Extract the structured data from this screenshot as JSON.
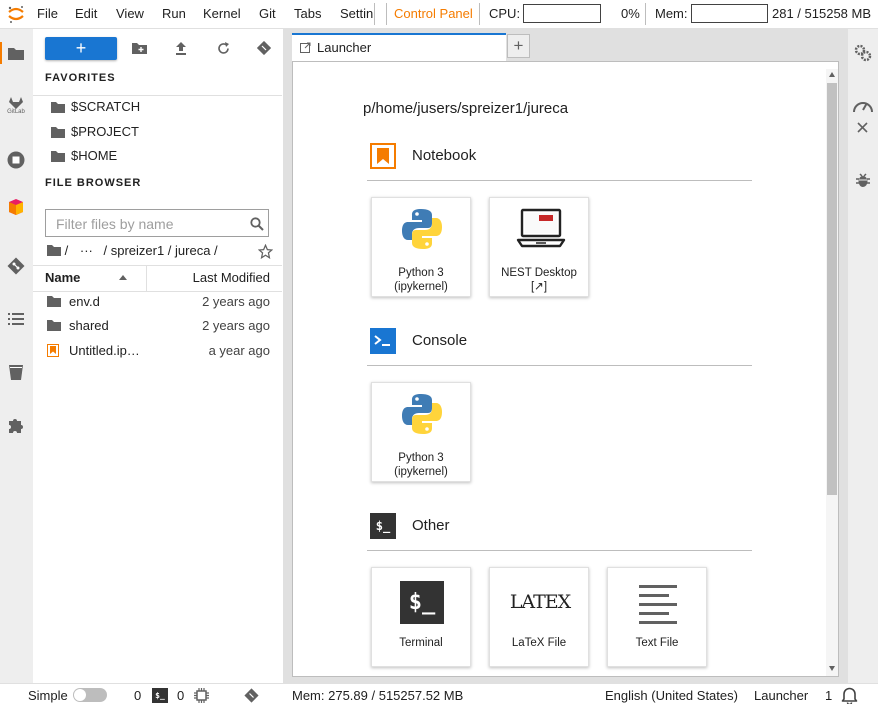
{
  "menubar": {
    "items": [
      "File",
      "Edit",
      "View",
      "Run",
      "Kernel",
      "Git",
      "Tabs",
      "Settin"
    ],
    "control_panel": "Control Panel",
    "cpu_label": "CPU:",
    "cpu_value": "0%",
    "mem_label": "Mem:",
    "mem_value": "281 / 515258 MB"
  },
  "filebrowser": {
    "new_button": "+",
    "favorites_title": "FAVORITES",
    "favorites": [
      "$SCRATCH",
      "$PROJECT",
      "$HOME"
    ],
    "browser_title": "FILE BROWSER",
    "filter_placeholder": "Filter files by name",
    "breadcrumb": {
      "root": "/",
      "ellipsis": "···",
      "rest": "/ spreizer1 / jureca /"
    },
    "columns": {
      "name": "Name",
      "modified": "Last Modified"
    },
    "files": [
      {
        "name": "env.d",
        "modified": "2 years ago",
        "kind": "folder"
      },
      {
        "name": "shared",
        "modified": "2 years ago",
        "kind": "folder"
      },
      {
        "name": "Untitled.ip…",
        "modified": "a year ago",
        "kind": "notebook"
      }
    ]
  },
  "tabs": {
    "launcher_label": "Launcher",
    "add_label": "+"
  },
  "launcher": {
    "cwd": "p/home/jusers/spreizer1/jureca",
    "notebook_title": "Notebook",
    "notebook_cards": [
      {
        "line1": "Python 3",
        "line2": "(ipykernel)"
      },
      {
        "line1": "NEST Desktop",
        "line2": "[↗]"
      }
    ],
    "console_title": "Console",
    "console_cards": [
      {
        "line1": "Python 3",
        "line2": "(ipykernel)"
      }
    ],
    "other_title": "Other",
    "other_cards": [
      {
        "line1": "Terminal",
        "line2": ""
      },
      {
        "line1": "LaTeX File",
        "line2": ""
      },
      {
        "line1": "Text File",
        "line2": ""
      }
    ],
    "other_latex_logo": "LATEX",
    "terminal_glyph": "$_"
  },
  "leftbar": {
    "gitlab_label": "GitLab"
  },
  "statusbar": {
    "mode_label": "Simple",
    "terminals_count": "0",
    "kernels_count": "0",
    "memory": "Mem: 275.89 / 515257.52 MB",
    "language": "English (United States)",
    "activity": "Launcher",
    "line": "1"
  },
  "colors": {
    "accent_blue": "#1976d2",
    "accent_orange": "#f57c00",
    "terminal_dark": "#333333"
  }
}
